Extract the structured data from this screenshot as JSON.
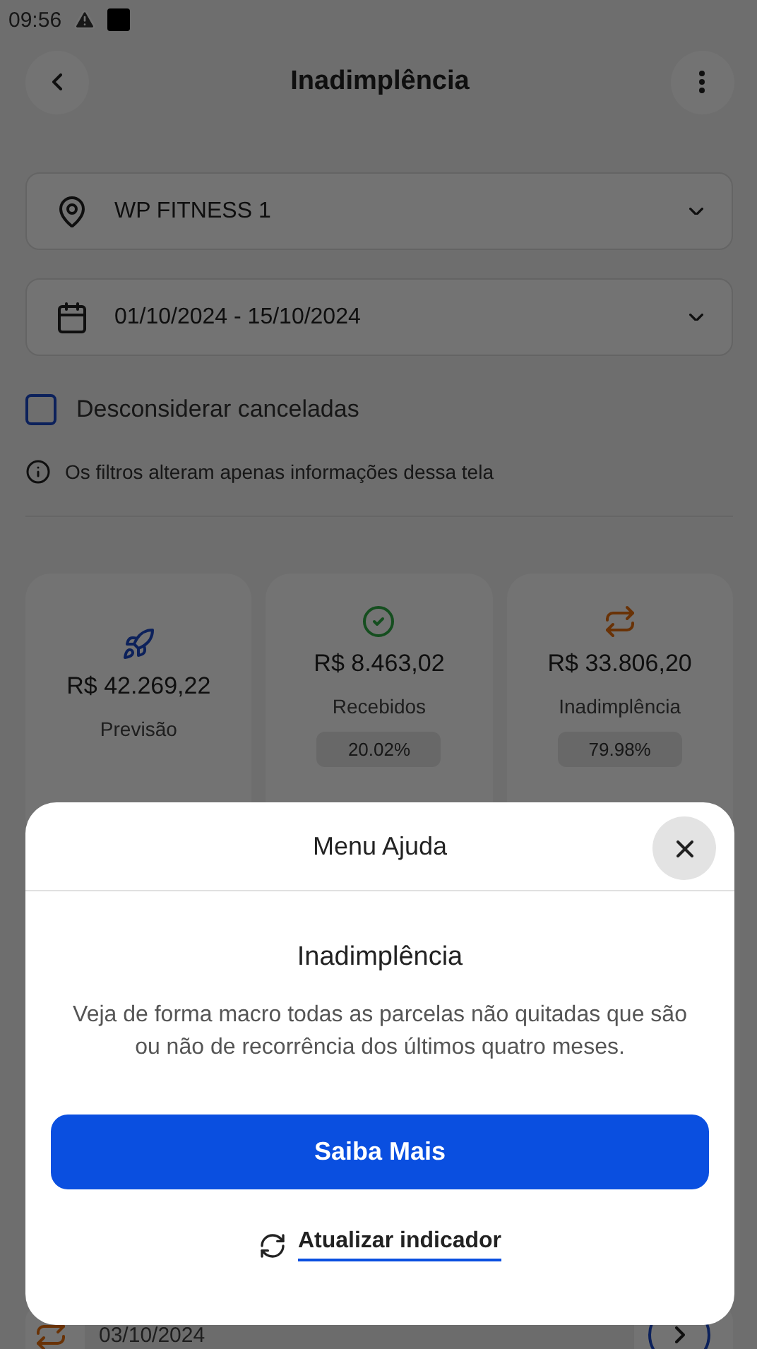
{
  "status_bar": {
    "time": "09:56"
  },
  "header": {
    "title": "Inadimplência"
  },
  "filters": {
    "unit": {
      "value": "WP FITNESS 1"
    },
    "period": {
      "value": "01/10/2024 - 15/10/2024"
    },
    "exclude_canceled": {
      "label": "Desconsiderar canceladas",
      "checked": false
    },
    "note": "Os filtros alteram apenas informações dessa tela"
  },
  "summary_cards": [
    {
      "kind": "forecast",
      "value": "R$ 42.269,22",
      "label": "Previsão"
    },
    {
      "kind": "received",
      "value": "R$ 8.463,02",
      "label": "Recebidos",
      "percent": "20.02%"
    },
    {
      "kind": "overdue",
      "value": "R$ 33.806,20",
      "label": "Inadimplência",
      "percent": "79.98%"
    }
  ],
  "list_rows": [
    {
      "date": "03/10/2024"
    }
  ],
  "help_sheet": {
    "title": "Menu Ajuda",
    "heading": "Inadimplência",
    "body": "Veja de forma macro todas as parcelas não quitadas que são ou não de recorrência dos últimos quatro meses.",
    "primary_button": "Saiba Mais",
    "link": "Atualizar indicador"
  }
}
